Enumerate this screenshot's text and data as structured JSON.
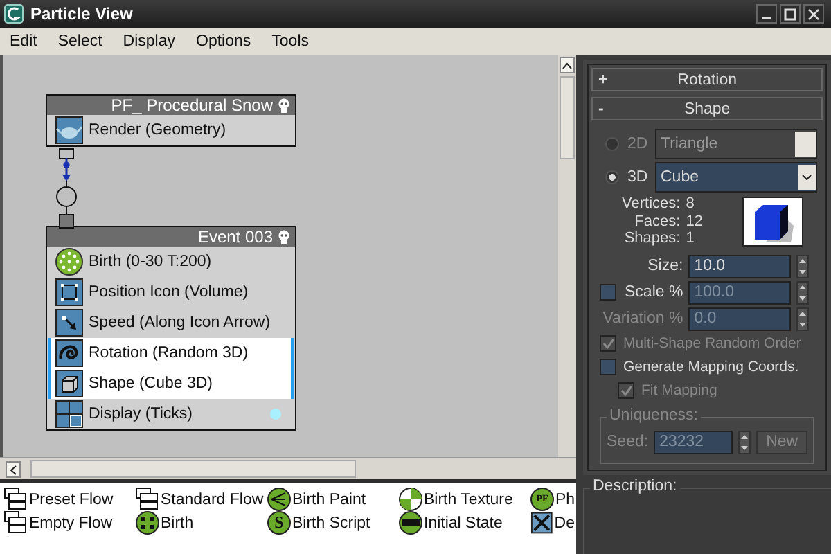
{
  "window": {
    "title": "Particle View"
  },
  "menu": [
    "Edit",
    "Select",
    "Display",
    "Options",
    "Tools"
  ],
  "nodes": [
    {
      "title": "PF_ Procedural Snow",
      "operators": [
        {
          "label": "Render (Geometry)",
          "kind": "render",
          "selected": false,
          "dot": false
        }
      ]
    },
    {
      "title": "Event 003",
      "operators": [
        {
          "label": "Birth  (0-30 T:200)",
          "kind": "birth",
          "selected": false,
          "dot": false
        },
        {
          "label": "Position Icon (Volume)",
          "kind": "position",
          "selected": false,
          "dot": false
        },
        {
          "label": "Speed  (Along Icon Arrow)",
          "kind": "speed",
          "selected": false,
          "dot": false
        },
        {
          "label": "Rotation  (Random 3D)",
          "kind": "rotation",
          "selected": true,
          "dot": false
        },
        {
          "label": "Shape  (Cube 3D)",
          "kind": "shape",
          "selected": true,
          "dot": false
        },
        {
          "label": "Display  (Ticks)",
          "kind": "display",
          "selected": false,
          "dot": true
        }
      ]
    }
  ],
  "depot": [
    {
      "label": "Preset Flow",
      "kind": "flow"
    },
    {
      "label": "Standard Flow",
      "kind": "flow"
    },
    {
      "label": "Birth Paint",
      "kind": "paint"
    },
    {
      "label": "Birth Texture",
      "kind": "texture"
    },
    {
      "label": "Ph",
      "kind": "glyph",
      "glyph": "PF"
    },
    {
      "label": "Empty Flow",
      "kind": "flow"
    },
    {
      "label": "Birth",
      "kind": "birth"
    },
    {
      "label": "Birth Script",
      "kind": "glyph",
      "glyph": "S"
    },
    {
      "label": "Initial State",
      "kind": "state"
    },
    {
      "label": "De",
      "kind": "cross"
    }
  ],
  "rollouts": [
    {
      "sign": "+",
      "label": "Rotation"
    },
    {
      "sign": "-",
      "label": "Shape"
    }
  ],
  "shape": {
    "radios": [
      {
        "label": "2D",
        "value": "Triangle",
        "selected": false
      },
      {
        "label": "3D",
        "value": "Cube",
        "selected": true
      }
    ],
    "stats": [
      {
        "label": "Vertices:",
        "value": "8"
      },
      {
        "label": "Faces:",
        "value": "12"
      },
      {
        "label": "Shapes:",
        "value": "1"
      }
    ],
    "spinners": [
      {
        "label": "Size:",
        "value": "10.0",
        "disabled": false
      },
      {
        "label": "Scale %",
        "value": "100.0",
        "disabled": true,
        "checkbox": true,
        "checked": false
      },
      {
        "label": "Variation %",
        "value": "0.0",
        "disabled": true
      }
    ],
    "checks": [
      {
        "label": "Multi-Shape Random Order",
        "checked": true,
        "disabled": true
      },
      {
        "label": "Generate Mapping Coords.",
        "checked": false,
        "disabled": false,
        "children": [
          {
            "label": "Fit Mapping",
            "checked": true,
            "disabled": true
          }
        ]
      }
    ],
    "uniqueness": {
      "title": "Uniqueness:",
      "seed_label": "Seed:",
      "seed": "23232",
      "button": "New",
      "disabled": true
    }
  },
  "description": {
    "title": "Description:"
  }
}
